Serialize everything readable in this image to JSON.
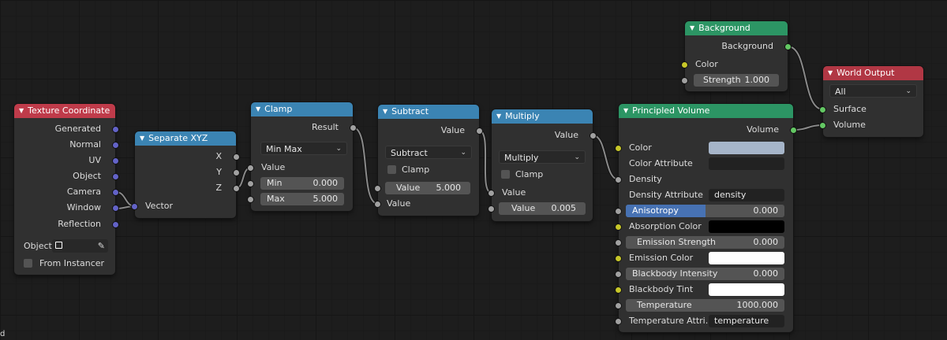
{
  "nodes": {
    "texture_coordinate": {
      "title": "Texture Coordinate",
      "outputs": [
        "Generated",
        "Normal",
        "UV",
        "Object",
        "Camera",
        "Window",
        "Reflection"
      ],
      "object_label": "Object:",
      "from_instancer": "From Instancer"
    },
    "separate_xyz": {
      "title": "Separate XYZ",
      "outputs": [
        "X",
        "Y",
        "Z"
      ],
      "input": "Vector"
    },
    "clamp": {
      "title": "Clamp",
      "output": "Result",
      "mode": "Min Max",
      "value_label": "Value",
      "min_label": "Min",
      "min_value": "0.000",
      "max_label": "Max",
      "max_value": "5.000"
    },
    "subtract": {
      "title": "Subtract",
      "output": "Value",
      "operation": "Subtract",
      "clamp_label": "Clamp",
      "value1_label": "Value",
      "value1": "5.000",
      "value2_label": "Value"
    },
    "multiply": {
      "title": "Multiply",
      "output": "Value",
      "operation": "Multiply",
      "clamp_label": "Clamp",
      "value1_label": "Value",
      "value2_label": "Value",
      "value2": "0.005"
    },
    "principled_volume": {
      "title": "Principled Volume",
      "output": "Volume",
      "color": "Color",
      "color_attribute": "Color Attribute",
      "density": "Density",
      "density_attribute": "Density Attribute",
      "density_attribute_value": "density",
      "anisotropy": "Anisotropy",
      "anisotropy_value": "0.000",
      "anisotropy_fraction": 0.5,
      "absorption_color": "Absorption Color",
      "emission_strength": "Emission Strength",
      "emission_strength_value": "0.000",
      "emission_color": "Emission Color",
      "blackbody_intensity": "Blackbody Intensity",
      "blackbody_intensity_value": "0.000",
      "blackbody_tint": "Blackbody Tint",
      "temperature": "Temperature",
      "temperature_value": "1000.000",
      "temperature_attribute": "Temperature Attri...",
      "temperature_attribute_value": "temperature"
    },
    "background": {
      "title": "Background",
      "output": "Background",
      "color": "Color",
      "strength_label": "Strength",
      "strength_value": "1.000"
    },
    "world_output": {
      "title": "World Output",
      "target": "All",
      "surface": "Surface",
      "volume": "Volume"
    }
  },
  "colors": {
    "texture_header": "#bf3b4a",
    "converter_header": "#3b84b3",
    "shader_header": "#2c9564",
    "output_header": "#b13744",
    "volume_color_swatch": "#a6b5c9",
    "absorption_color_swatch": "#000000",
    "emission_color_swatch": "#ffffff",
    "blackbody_tint_swatch": "#ffffff"
  },
  "corner_text": "d"
}
